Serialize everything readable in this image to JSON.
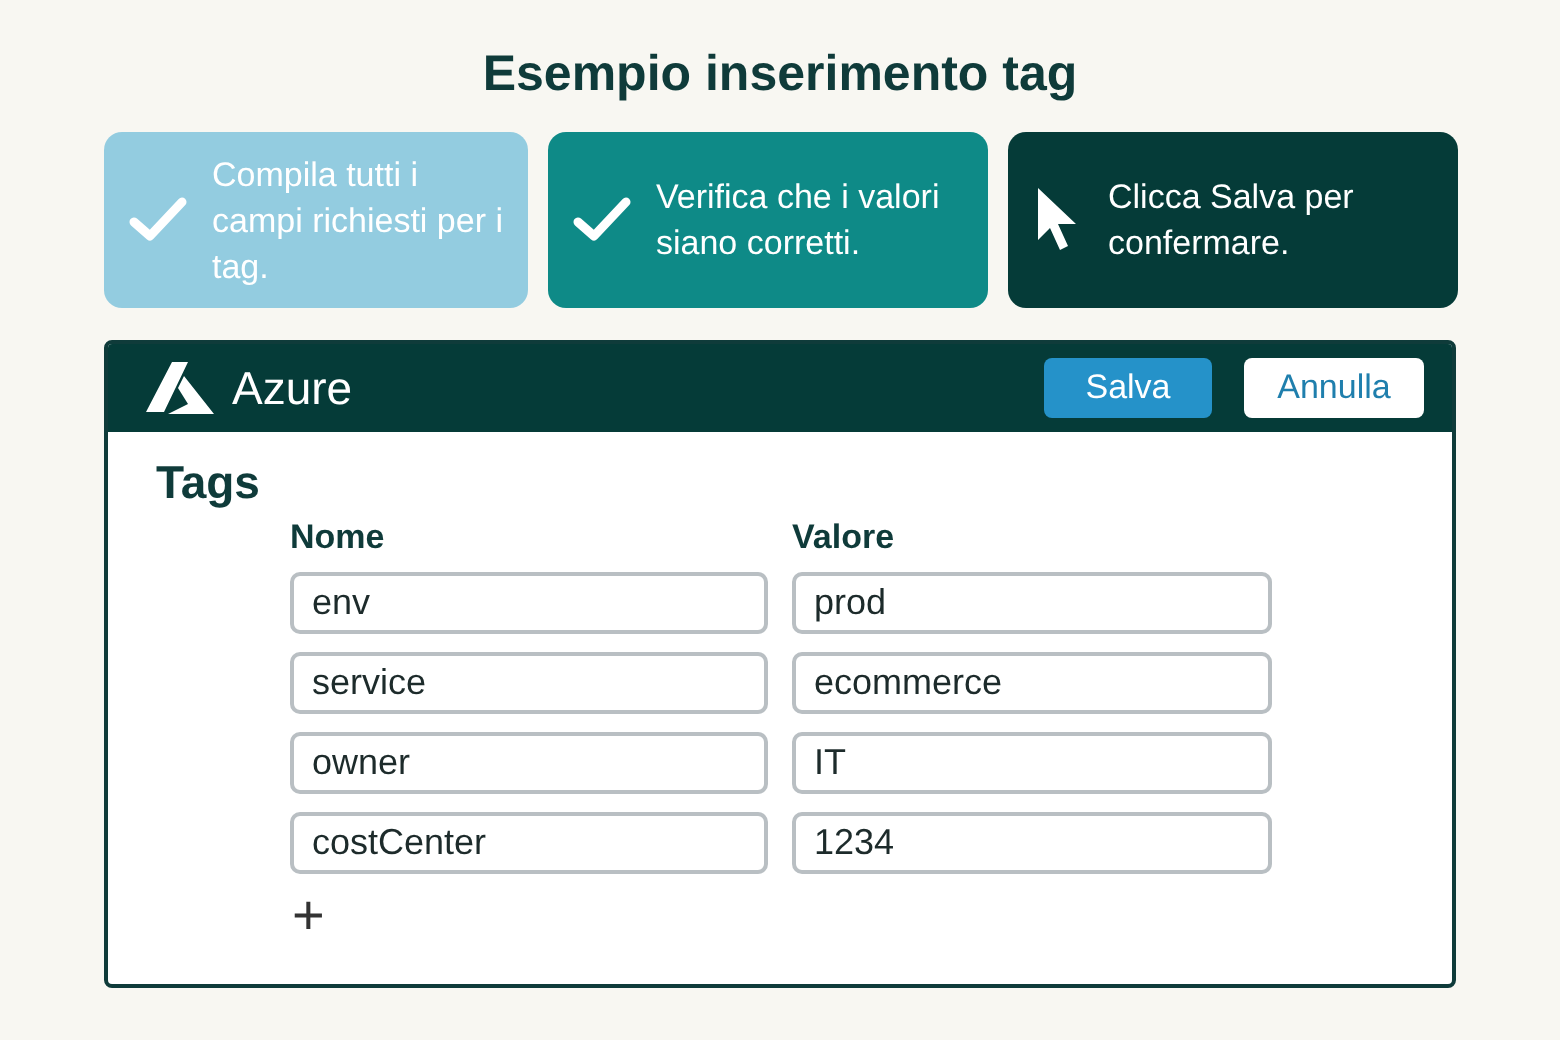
{
  "title": "Esempio inserimento tag",
  "steps": [
    {
      "kind": "check",
      "color": "#93cce0",
      "text": "Compila tutti i campi richiesti per i tag."
    },
    {
      "kind": "check",
      "color": "#0e8a87",
      "text": "Verifica che i valori siano corretti."
    },
    {
      "kind": "cursor",
      "color": "#053b38",
      "text": "Clicca Salva per confermare."
    }
  ],
  "panel": {
    "brand": "Azure",
    "buttons": [
      {
        "label": "Salva",
        "kind": "primary"
      },
      {
        "label": "Annulla",
        "kind": "secondary"
      }
    ],
    "heading": "Tags",
    "columns": [
      "Nome",
      "Valore"
    ],
    "rows": [
      {
        "name": "env",
        "value": "prod"
      },
      {
        "name": "service",
        "value": "ecommerce"
      },
      {
        "name": "owner",
        "value": "IT"
      },
      {
        "name": "costCenter",
        "value": "1234"
      }
    ],
    "add": "+"
  }
}
